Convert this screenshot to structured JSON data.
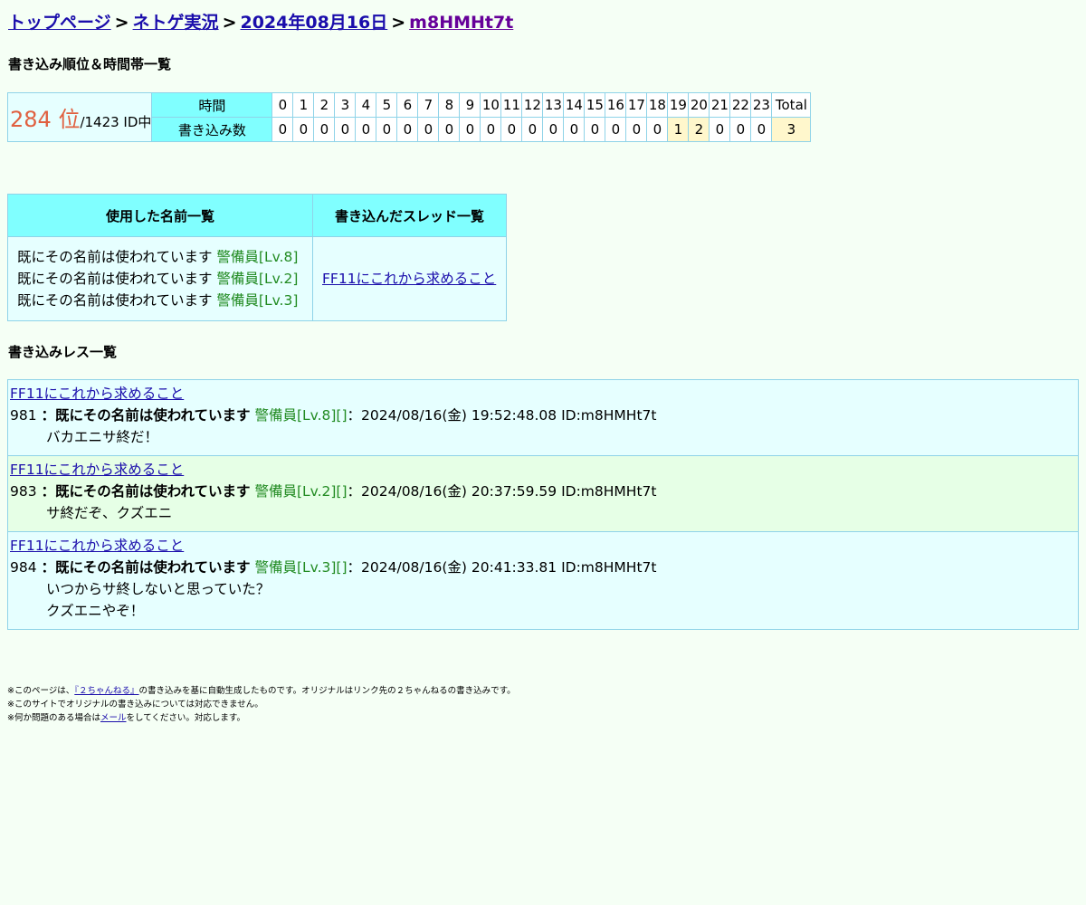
{
  "breadcrumb": {
    "top": "トップページ",
    "board": "ネトゲ実況",
    "date": "2024年08月16日",
    "id": "m8HMHt7t",
    "separator": ">"
  },
  "rank_section_title": "書き込み順位＆時間帯一覧",
  "rank": {
    "position": "284 位",
    "total": "/1423 ID中",
    "time_header": "時間",
    "count_header": "書き込み数",
    "hours": [
      "0",
      "1",
      "2",
      "3",
      "4",
      "5",
      "6",
      "7",
      "8",
      "9",
      "10",
      "11",
      "12",
      "13",
      "14",
      "15",
      "16",
      "17",
      "18",
      "19",
      "20",
      "21",
      "22",
      "23",
      "Total"
    ],
    "counts": [
      "0",
      "0",
      "0",
      "0",
      "0",
      "0",
      "0",
      "0",
      "0",
      "0",
      "0",
      "0",
      "0",
      "0",
      "0",
      "0",
      "0",
      "0",
      "0",
      "1",
      "2",
      "0",
      "0",
      "0",
      "3"
    ]
  },
  "names_header": "使用した名前一覧",
  "threads_header": "書き込んだスレッド一覧",
  "names": [
    {
      "name": "既にその名前は使われています",
      "level": "警備員[Lv.8]"
    },
    {
      "name": "既にその名前は使われています",
      "level": "警備員[Lv.2]"
    },
    {
      "name": "既にその名前は使われています",
      "level": "警備員[Lv.3]"
    }
  ],
  "threads": [
    "FF11にこれから求めること"
  ],
  "posts_section_title": "書き込みレス一覧",
  "posts": [
    {
      "thread": "FF11にこれから求めること",
      "num": "981",
      "colon": "：",
      "name": "既にその名前は使われています",
      "level": "警備員[Lv.8][]",
      "meta": "：2024/08/16(金) 19:52:48.08 ID:m8HMHt7t",
      "lines": [
        "バカエニサ終だ！"
      ]
    },
    {
      "thread": "FF11にこれから求めること",
      "num": "983",
      "colon": "：",
      "name": "既にその名前は使われています",
      "level": "警備員[Lv.2][]",
      "meta": "：2024/08/16(金) 20:37:59.59 ID:m8HMHt7t",
      "lines": [
        "サ終だぞ、クズエニ"
      ]
    },
    {
      "thread": "FF11にこれから求めること",
      "num": "984",
      "colon": "：",
      "name": "既にその名前は使われています",
      "level": "警備員[Lv.3][]",
      "meta": "：2024/08/16(金) 20:41:33.81 ID:m8HMHt7t",
      "lines": [
        "いつからサ終しないと思っていた？",
        "クズエニやぞ！"
      ]
    }
  ],
  "footer": {
    "line1_a": "※このページは、",
    "line1_link": "『２ちゃんねる』",
    "line1_b": "の書き込みを基に自動生成したものです。オリジナルはリンク先の２ちゃんねるの書き込みです。",
    "line2": "※このサイトでオリジナルの書き込みについては対応できません。",
    "line3_a": "※何か問題のある場合は",
    "line3_link": "メール",
    "line3_b": "をしてください。対応します。"
  }
}
